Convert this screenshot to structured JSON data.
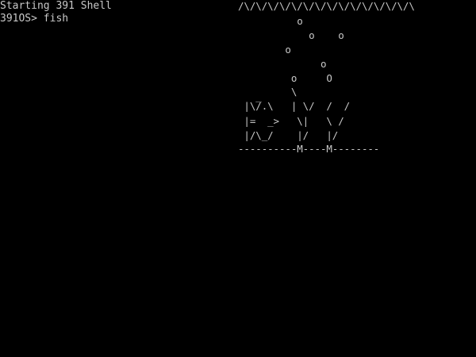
{
  "terminal": {
    "lines": [
      "Starting 391 Shell",
      "391OS> fish"
    ]
  },
  "aquarium": {
    "rows": [
      "/\\/\\/\\/\\/\\/\\/\\/\\/\\/\\/\\/\\/\\/\\/\\",
      "          o",
      "            o    o",
      "        o",
      "              o",
      "         o     O",
      "         \\",
      "   _",
      " |\\/.\\   | \\/  /  /",
      " |=  _>   \\|   \\ /",
      " |/\\_/    |/   |/",
      "----------M----M--------"
    ]
  },
  "colors": {
    "background": "#000000",
    "foreground": "#c8c8c8"
  }
}
